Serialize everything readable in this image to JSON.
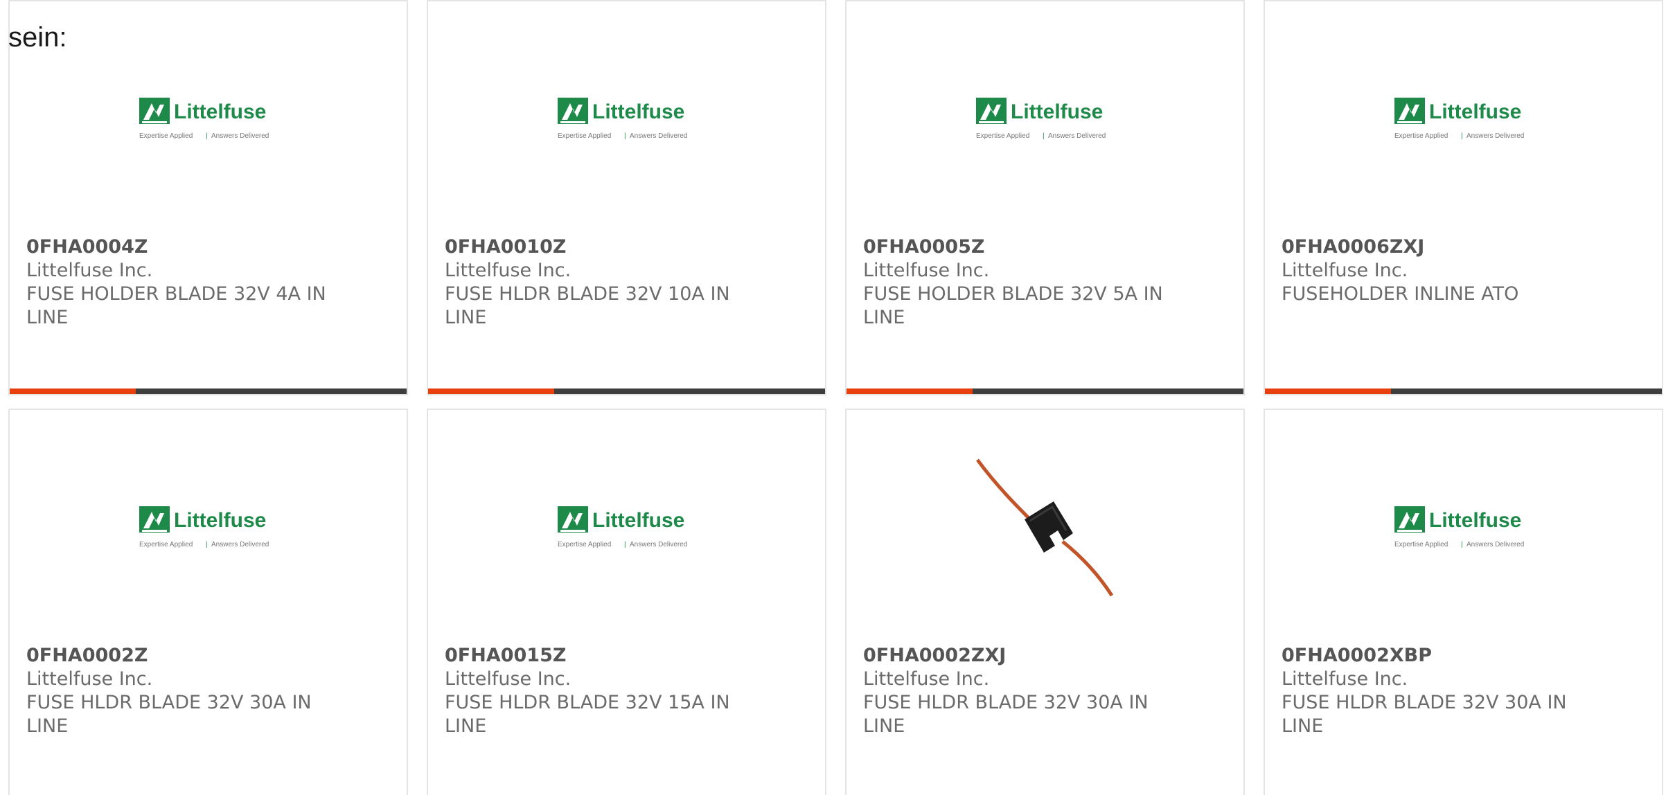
{
  "intro_text": "sein:",
  "colors": {
    "accent": "#e8400d",
    "bar": "#3e3e3e",
    "logo_green": "#1e8a4a",
    "text": "#6b6b6b"
  },
  "logo": {
    "brand": "Littelfuse",
    "tagline_left": "Expertise Applied",
    "tagline_right": "Answers Delivered"
  },
  "products": [
    {
      "part": "0FHA0004Z",
      "maker": "Littelfuse Inc.",
      "desc_line1": "FUSE HOLDER BLADE 32V 4A IN",
      "desc_line2": "LINE",
      "image": "littelfuse-logo"
    },
    {
      "part": "0FHA0010Z",
      "maker": "Littelfuse Inc.",
      "desc_line1": "FUSE HLDR BLADE 32V 10A IN",
      "desc_line2": "LINE",
      "image": "littelfuse-logo"
    },
    {
      "part": "0FHA0005Z",
      "maker": "Littelfuse Inc.",
      "desc_line1": "FUSE HOLDER BLADE 32V 5A IN",
      "desc_line2": "LINE",
      "image": "littelfuse-logo"
    },
    {
      "part": "0FHA0006ZXJ",
      "maker": "Littelfuse Inc.",
      "desc_line1": "FUSEHOLDER INLINE ATO",
      "desc_line2": "",
      "image": "littelfuse-logo"
    },
    {
      "part": "0FHA0002Z",
      "maker": "Littelfuse Inc.",
      "desc_line1": "FUSE HLDR BLADE 32V 30A IN",
      "desc_line2": "LINE",
      "image": "littelfuse-logo"
    },
    {
      "part": "0FHA0015Z",
      "maker": "Littelfuse Inc.",
      "desc_line1": "FUSE HLDR BLADE 32V 15A IN",
      "desc_line2": "LINE",
      "image": "littelfuse-logo"
    },
    {
      "part": "0FHA0002ZXJ",
      "maker": "Littelfuse Inc.",
      "desc_line1": "FUSE HLDR BLADE 32V 30A IN",
      "desc_line2": "LINE",
      "image": "inline-fuse-holder-photo"
    },
    {
      "part": "0FHA0002XBP",
      "maker": "Littelfuse Inc.",
      "desc_line1": "FUSE HLDR BLADE 32V 30A IN",
      "desc_line2": "LINE",
      "image": "littelfuse-logo"
    }
  ]
}
